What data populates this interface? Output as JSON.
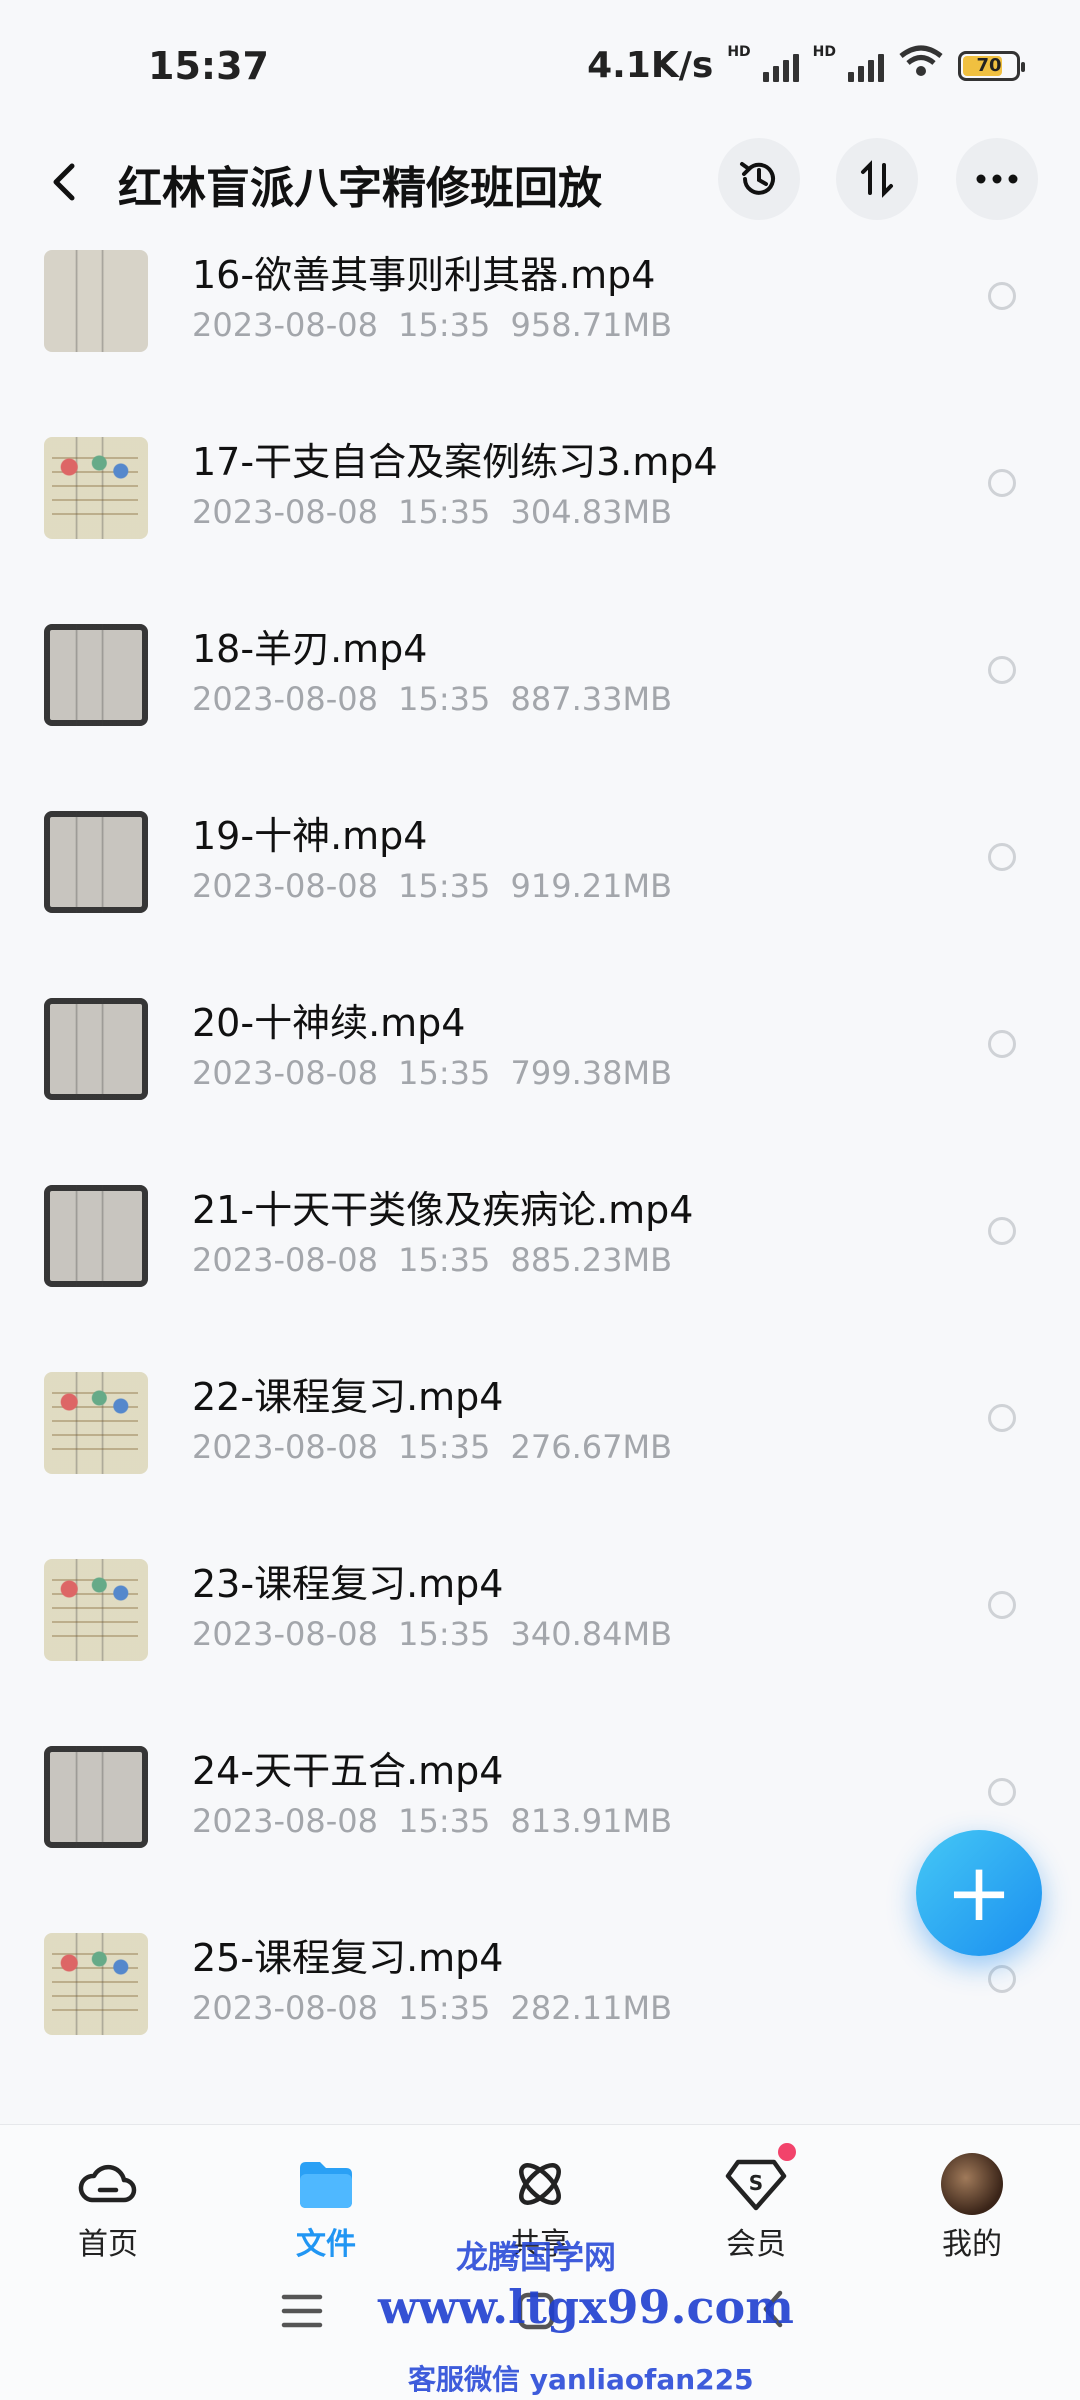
{
  "status_bar": {
    "time": "15:37",
    "speed": "4.1K/s",
    "hd1": "HD",
    "hd2": "HD",
    "battery": "70"
  },
  "header": {
    "title": "红林盲派八字精修班回放"
  },
  "files": [
    {
      "name": "16-欲善其事则利其器.mp4",
      "date": "2023-08-08",
      "time": "15:35",
      "size": "958.71MB",
      "thumb": "paper"
    },
    {
      "name": "17-干支自合及案例练习3.mp4",
      "date": "2023-08-08",
      "time": "15:35",
      "size": "304.83MB",
      "thumb": "color"
    },
    {
      "name": "18-羊刃.mp4",
      "date": "2023-08-08",
      "time": "15:35",
      "size": "887.33MB",
      "thumb": "dark"
    },
    {
      "name": "19-十神.mp4",
      "date": "2023-08-08",
      "time": "15:35",
      "size": "919.21MB",
      "thumb": "dark"
    },
    {
      "name": "20-十神续.mp4",
      "date": "2023-08-08",
      "time": "15:35",
      "size": "799.38MB",
      "thumb": "dark"
    },
    {
      "name": "21-十天干类像及疾病论.mp4",
      "date": "2023-08-08",
      "time": "15:35",
      "size": "885.23MB",
      "thumb": "dark"
    },
    {
      "name": "22-课程复习.mp4",
      "date": "2023-08-08",
      "time": "15:35",
      "size": "276.67MB",
      "thumb": "color"
    },
    {
      "name": "23-课程复习.mp4",
      "date": "2023-08-08",
      "time": "15:35",
      "size": "340.84MB",
      "thumb": "color"
    },
    {
      "name": "24-天干五合.mp4",
      "date": "2023-08-08",
      "time": "15:35",
      "size": "813.91MB",
      "thumb": "dark"
    },
    {
      "name": "25-课程复习.mp4",
      "date": "2023-08-08",
      "time": "15:35",
      "size": "282.11MB",
      "thumb": "color"
    }
  ],
  "fab": {
    "label": "+"
  },
  "bottom_nav": [
    {
      "label": "首页",
      "icon": "cloud-icon",
      "active": false
    },
    {
      "label": "文件",
      "icon": "folder-icon",
      "active": true
    },
    {
      "label": "共享",
      "icon": "share-icon",
      "active": false
    },
    {
      "label": "会员",
      "icon": "vip-icon",
      "active": false
    },
    {
      "label": "我的",
      "icon": "avatar",
      "active": false
    }
  ],
  "watermark": {
    "line1": "龙腾国学网",
    "line2": "www.ltgx99.com",
    "line3": "客服微信 yanliaofan225"
  },
  "colors": {
    "accent": "#2196f3",
    "fab": "#1a8ef0",
    "badge": "#f2436b",
    "meta": "#a3a6ab"
  }
}
